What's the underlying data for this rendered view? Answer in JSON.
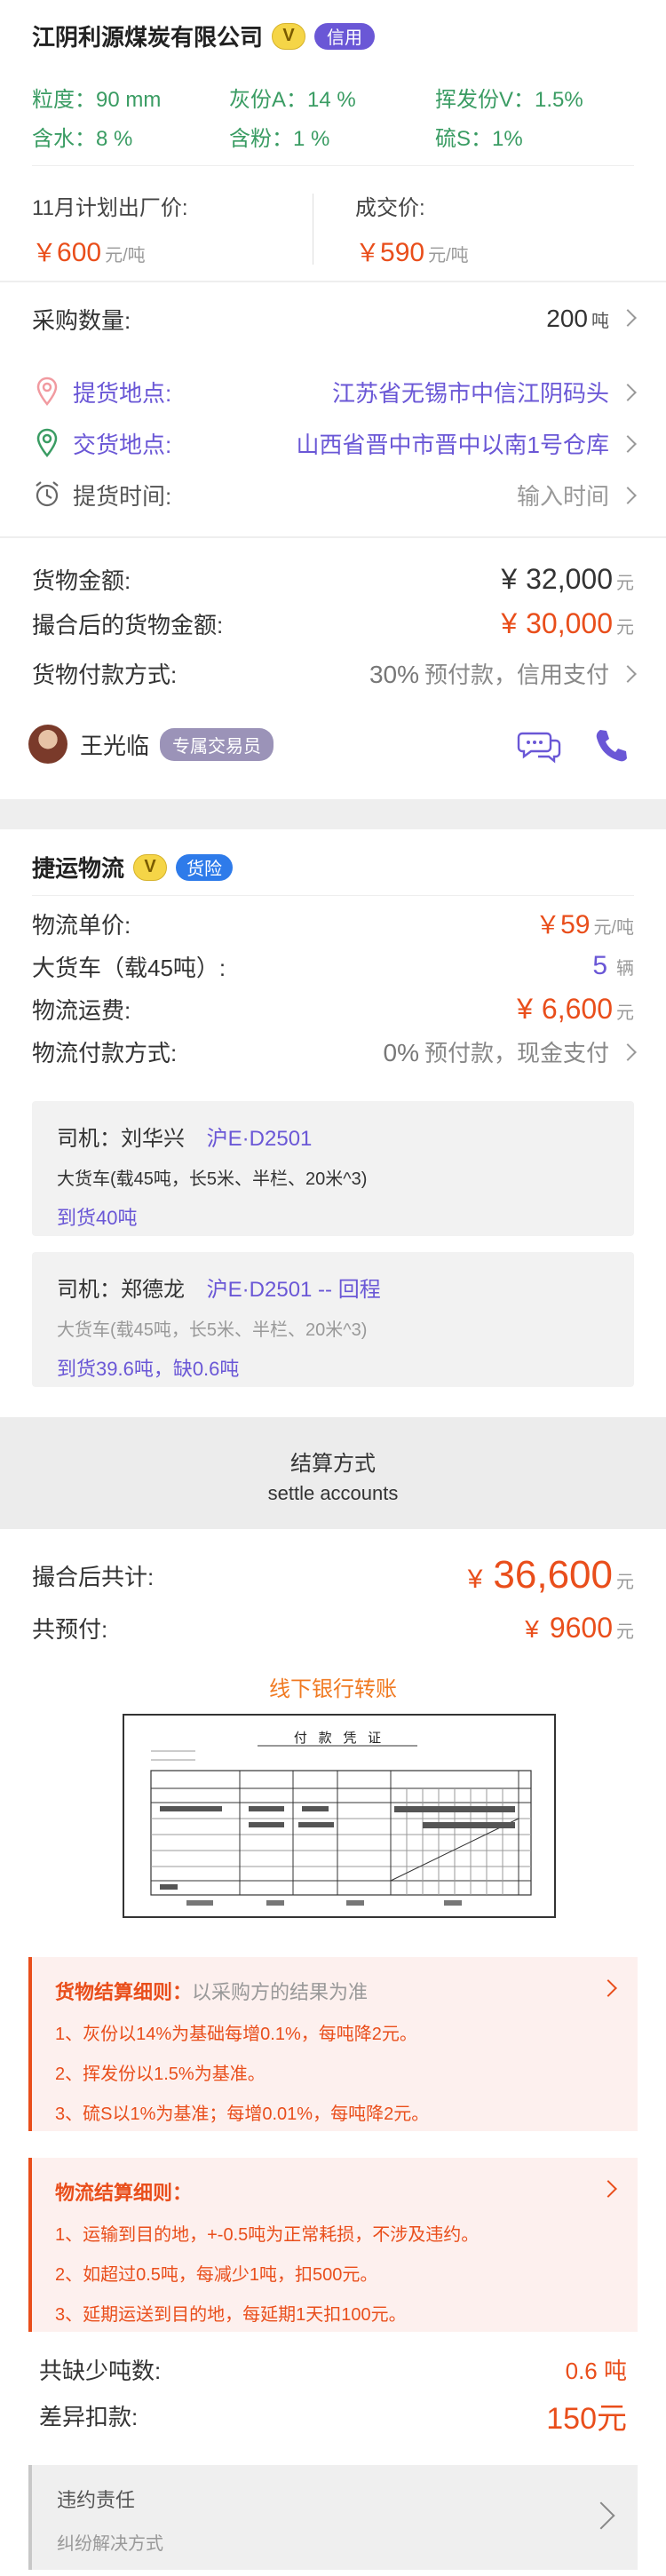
{
  "supplier": {
    "name": "江阴利源煤炭有限公司",
    "v_badge": "V",
    "credit_badge": "信用",
    "specs": [
      {
        "label": "粒度：",
        "value": "90 mm"
      },
      {
        "label": "灰份A：",
        "value": "14 %"
      },
      {
        "label": "挥发份V：",
        "value": "1.5%"
      },
      {
        "label": "含水：",
        "value": "8 %"
      },
      {
        "label": "含粉：",
        "value": "1 %"
      },
      {
        "label": "硫S：",
        "value": "1%"
      }
    ]
  },
  "prices": {
    "plan_label": "11月计划出厂价:",
    "plan_symbol": "￥",
    "plan_value": "600",
    "plan_unit": "元/吨",
    "deal_label": "成交价:",
    "deal_symbol": "￥",
    "deal_value": "590",
    "deal_unit": "元/吨"
  },
  "purchase": {
    "qty_label": "采购数量:",
    "qty_value": "200",
    "qty_unit": "吨",
    "pickup_label": "提货地点:",
    "pickup_value": "江苏省无锡市中信江阴码头",
    "delivery_label": "交货地点:",
    "delivery_value": "山西省晋中市晋中以南1号仓库",
    "time_label": "提货时间:",
    "time_placeholder": "输入时间"
  },
  "amounts": {
    "goods_label": "货物金额:",
    "goods_symbol": "¥",
    "goods_value": "32,000",
    "goods_unit": "元",
    "matched_label": "撮合后的货物金额:",
    "matched_symbol": "¥",
    "matched_value": "30,000",
    "matched_unit": "元",
    "pay_label": "货物付款方式:",
    "pay_percent": "30%",
    "pay_text": "预付款，信用支付"
  },
  "agent": {
    "name": "王光临",
    "tag": "专属交易员"
  },
  "logistics": {
    "company": "捷运物流",
    "v_badge": "V",
    "insurance_badge": "货险",
    "unit_label": "物流单价:",
    "unit_symbol": "￥",
    "unit_value": "59",
    "unit_unit": "元/吨",
    "truck_label": "大货车（载45吨）:",
    "truck_value": "5",
    "truck_unit": "辆",
    "fee_label": "物流运费:",
    "fee_symbol": "¥",
    "fee_value": "6,600",
    "fee_unit": "元",
    "pay_label": "物流付款方式:",
    "pay_percent": "0%",
    "pay_text": "预付款，现金支付"
  },
  "drivers": [
    {
      "label": "司机：",
      "name": "刘华兴",
      "plate": "沪E·D2501",
      "truck": "大货车(载45吨，长5米、半栏、20米^3)",
      "status": "到货40吨"
    },
    {
      "label": "司机：",
      "name": "郑德龙",
      "plate": "沪E·D2501 -- 回程",
      "truck": "大货车(载45吨，长5米、半栏、20米^3)",
      "status": "到货39.6吨，缺0.6吨"
    }
  ],
  "settle": {
    "title_cn": "结算方式",
    "title_en": "settle accounts",
    "total_label": "撮合后共计:",
    "total_symbol": "¥",
    "total_value": "36,600",
    "total_unit": "元",
    "prepay_label": "共预付:",
    "prepay_symbol": "¥",
    "prepay_value": "9600",
    "prepay_unit": "元",
    "bank_transfer": "线下银行转账",
    "voucher_title": "付 款 凭 证"
  },
  "goods_rules": {
    "title": "货物结算细则：",
    "subtitle": "以采购方的结果为准",
    "lines": [
      "1、灰份以14%为基础每增0.1%，每吨降2元。",
      "2、挥发份以1.5%为基准。",
      "3、硫S以1%为基准；每增0.01%，每吨降2元。"
    ]
  },
  "logistics_rules": {
    "title": "物流结算细则：",
    "lines": [
      "1、运输到目的地，+-0.5吨为正常耗损，不涉及违约。",
      "2、如超过0.5吨，每减少1吨，扣500元。",
      "3、延期运送到目的地，每延期1天扣100元。"
    ]
  },
  "shortage": {
    "label": "共缺少吨数:",
    "value": "0.6 吨",
    "deduct_label": "差异扣款:",
    "deduct_value": "150元"
  },
  "dispute": {
    "title": "违约责任",
    "subtitle": "纠纷解决方式"
  }
}
